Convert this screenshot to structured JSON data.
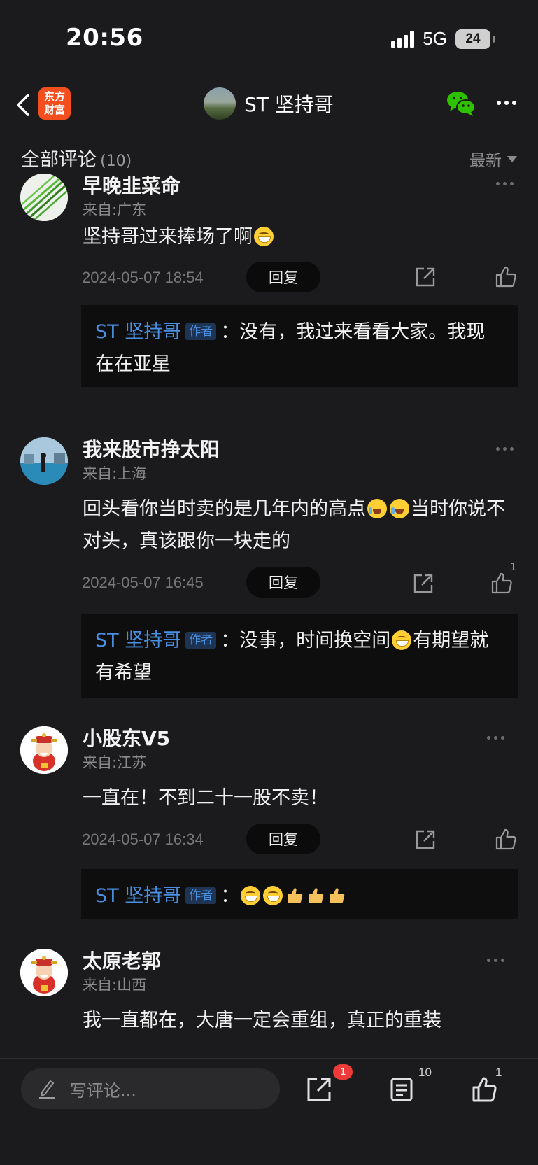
{
  "status_bar": {
    "time": "20:56",
    "network": "5G",
    "battery": "24"
  },
  "nav": {
    "brand_line1": "东方",
    "brand_line2": "财富",
    "title": "ST 坚持哥"
  },
  "comments_header": {
    "title": "全部评论",
    "count": "(10)",
    "sort": "最新"
  },
  "comments": [
    {
      "name": "早晚韭菜命",
      "location": "来自:广东",
      "text": "坚持哥过来捧场了啊",
      "time": "2024-05-07 18:54",
      "reply_label": "回复",
      "likes": "",
      "reply": {
        "author": "ST 坚持哥",
        "tag": "作者",
        "sep": "：",
        "text": "没有，我过来看看大家。我现在在亚星"
      }
    },
    {
      "name": "我来股市挣太阳",
      "location": "来自:上海",
      "text_a": "回头看你当时卖的是几年内的高点",
      "text_b": "当时你说不对头，真该跟你一块走的",
      "time": "2024-05-07 16:45",
      "reply_label": "回复",
      "likes": "1",
      "reply": {
        "author": "ST 坚持哥",
        "tag": "作者",
        "sep": "：",
        "text_a": "没事，时间换空间",
        "text_b": "有期望就有希望"
      }
    },
    {
      "name": "小股东V5",
      "location": "来自:江苏",
      "text": "一直在！不到二十一股不卖！",
      "time": "2024-05-07 16:34",
      "reply_label": "回复",
      "likes": "",
      "reply": {
        "author": "ST 坚持哥",
        "tag": "作者",
        "sep": "："
      }
    },
    {
      "name": "太原老郭",
      "location": "来自:山西",
      "text": "我一直都在，大唐一定会重组，真正的重装"
    }
  ],
  "bottom_bar": {
    "placeholder": "写评论...",
    "share_badge": "1",
    "comment_count": "10",
    "like_count": "1"
  },
  "colors": {
    "background": "#1b1b1d",
    "accent_blue": "#4a90e2",
    "badge_red": "#ef3a3a",
    "brand_orange": "#f24e1e",
    "wechat_green": "#2dc100"
  }
}
